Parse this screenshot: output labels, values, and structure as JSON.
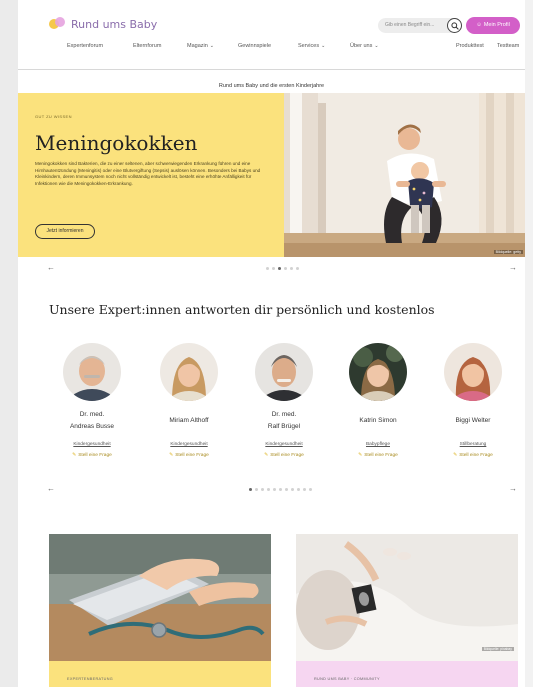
{
  "header": {
    "logo_text": "Rund ums Baby",
    "search_placeholder": "Gib einen Begriff ein...",
    "profile_label": "Mein Profil"
  },
  "nav": [
    {
      "label": "Expertenforum",
      "dropdown": false
    },
    {
      "label": "Elternforum",
      "dropdown": false
    },
    {
      "label": "Magazin",
      "dropdown": true
    },
    {
      "label": "Gewinnspiele",
      "dropdown": false
    },
    {
      "label": "Services",
      "dropdown": true
    },
    {
      "label": "Über uns",
      "dropdown": true
    },
    {
      "label": "Produkttest",
      "dropdown": false
    },
    {
      "label": "Testteam",
      "dropdown": false
    }
  ],
  "tagline": "Rund ums Baby und die ersten Kinderjahre",
  "hero": {
    "eyebrow": "GUT ZU WISSEN",
    "title": "Meningokokken",
    "body": "Meningokokken sind Bakterien, die zu einer seltenen, aber schwerwiegenden Erkrankung führen und eine Hirnhautentzündung (Meningitis) oder eine Blutvergiftung (Sepsis) auslösen können. Besonders bei Babys und Kleinkindern, deren Immunsystem noch nicht vollständig entwickelt ist, besteht eine erhöhte Anfälligkeit für Infektionen wie die Meningokokken-Erkrankung.",
    "button": "Jetzt informieren",
    "credit": "Bildquelle: getty"
  },
  "hero_carousel": {
    "prev": "←",
    "next": "→",
    "dots": 6,
    "active": 2
  },
  "experts": {
    "heading": "Unsere Expert:innen antworten dir persönlich und kostenlos",
    "ask_label": "Stell eine Frage",
    "items": [
      {
        "name": "Dr. med.\nAndreas Busse",
        "field": "Kindergesundheit",
        "ask": "Stell eine Frage"
      },
      {
        "name": "Miriam Althoff",
        "field": "Kindergesundheit",
        "ask": "Stell eine Frage"
      },
      {
        "name": "Dr. med.\nRalf Brügel",
        "field": "Kindergesundheit",
        "ask": "Stell eine Frage"
      },
      {
        "name": "Katrin Simon",
        "field": "Babypflege",
        "ask": "Stell eine Frage"
      },
      {
        "name": "Biggi Welter",
        "field": "Stillberatung",
        "ask": "Stell eine Frage"
      }
    ],
    "carousel": {
      "prev": "←",
      "next": "→",
      "dots": 11,
      "active": 0
    }
  },
  "cards": [
    {
      "label": "EXPERTENBERATUNG",
      "band_color": "#fbe27d"
    },
    {
      "label": "RUND UMS BABY · COMMUNITY",
      "band_color": "#f6d6f1",
      "credit": "Bildquelle: pixabay"
    }
  ],
  "colors": {
    "accent": "#d35fc8",
    "hero_yellow": "#fbe27d",
    "logo_purple": "#8a6dab"
  }
}
